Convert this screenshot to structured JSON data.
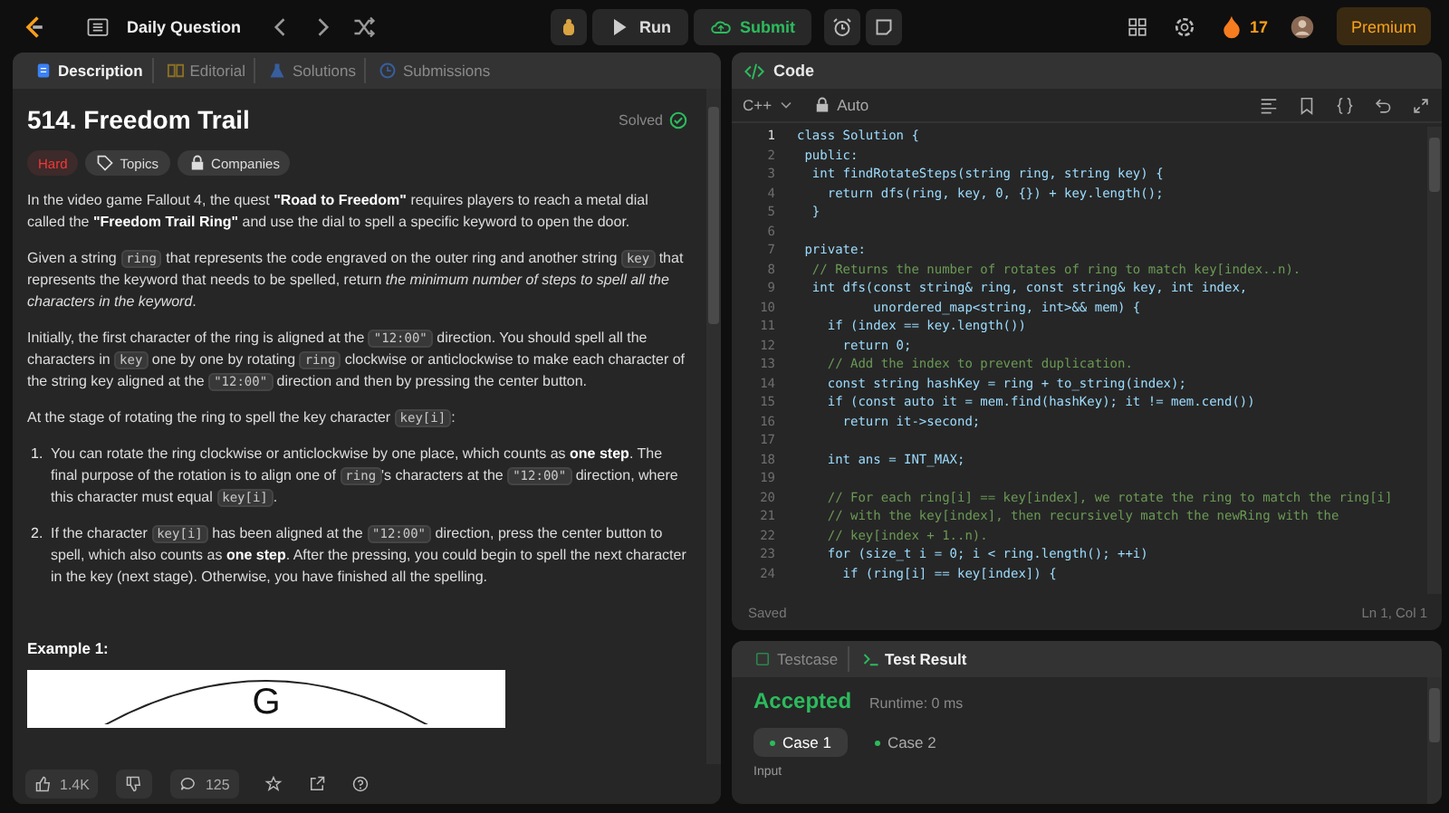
{
  "top_bar": {
    "nav_label": "Daily Question",
    "run_label": "Run",
    "submit_label": "Submit",
    "streak": "17",
    "premium_label": "Premium"
  },
  "description_panel": {
    "tabs": [
      {
        "label": "Description",
        "selected": true
      },
      {
        "label": "Editorial",
        "selected": false
      },
      {
        "label": "Solutions",
        "selected": false
      },
      {
        "label": "Submissions",
        "selected": false
      }
    ],
    "title": "514. Freedom Trail",
    "status": "Solved",
    "tags": [
      {
        "label": "Hard",
        "kind": "difficulty"
      },
      {
        "label": "Topics",
        "kind": "topic"
      },
      {
        "label": "Companies",
        "kind": "company"
      }
    ],
    "paragraphs": [
      [
        {
          "kind": "text",
          "text": "In the video game Fallout 4, the quest "
        },
        {
          "kind": "bold",
          "text": "\"Road to Freedom\""
        },
        {
          "kind": "text",
          "text": " requires players to reach a metal dial called the "
        },
        {
          "kind": "bold",
          "text": "\"Freedom Trail Ring\""
        },
        {
          "kind": "text",
          "text": " and use the dial to spell a specific keyword to open the door."
        }
      ],
      [
        {
          "kind": "text",
          "text": "Given a string "
        },
        {
          "kind": "code",
          "text": "ring"
        },
        {
          "kind": "text",
          "text": " that represents the code engraved on the outer ring and another string "
        },
        {
          "kind": "code",
          "text": "key"
        },
        {
          "kind": "text",
          "text": " that represents the keyword that needs to be spelled, return "
        },
        {
          "kind": "italic",
          "text": "the minimum number of steps to spell all the characters in the keyword"
        },
        {
          "kind": "text",
          "text": "."
        }
      ],
      [
        {
          "kind": "text",
          "text": "Initially, the first character of the ring is aligned at the "
        },
        {
          "kind": "code",
          "text": "\"12:00\""
        },
        {
          "kind": "text",
          "text": " direction. You should spell all the characters in "
        },
        {
          "kind": "code",
          "text": "key"
        },
        {
          "kind": "text",
          "text": " one by one by rotating "
        },
        {
          "kind": "code",
          "text": "ring"
        },
        {
          "kind": "text",
          "text": " clockwise or anticlockwise to make each character of the string key aligned at the "
        },
        {
          "kind": "code",
          "text": "\"12:00\""
        },
        {
          "kind": "text",
          "text": " direction and then by pressing the center button."
        }
      ],
      [
        {
          "kind": "text",
          "text": "At the stage of rotating the ring to spell the key character "
        },
        {
          "kind": "code",
          "text": "key[i]"
        },
        {
          "kind": "text",
          "text": ":"
        }
      ]
    ],
    "steps": [
      {
        "number": "1.",
        "segments": [
          {
            "kind": "text",
            "text": "You can rotate the ring clockwise or anticlockwise by one place, which counts as "
          },
          {
            "kind": "bold",
            "text": "one step"
          },
          {
            "kind": "text",
            "text": ". The final purpose of the rotation is to align one of "
          },
          {
            "kind": "code",
            "text": "ring"
          },
          {
            "kind": "text",
            "text": "'s characters at the "
          },
          {
            "kind": "code",
            "text": "\"12:00\""
          },
          {
            "kind": "text",
            "text": " direction, where this character must equal "
          },
          {
            "kind": "code",
            "text": "key[i]"
          },
          {
            "kind": "text",
            "text": "."
          }
        ]
      },
      {
        "number": "2.",
        "segments": [
          {
            "kind": "text",
            "text": "If the character "
          },
          {
            "kind": "code",
            "text": "key[i]"
          },
          {
            "kind": "text",
            "text": " has been aligned at the "
          },
          {
            "kind": "code",
            "text": "\"12:00\""
          },
          {
            "kind": "text",
            "text": " direction, press the center button to spell, which also counts as "
          },
          {
            "kind": "bold",
            "text": "one step"
          },
          {
            "kind": "text",
            "text": ". After the pressing, you could begin to spell the next character in the key (next stage). Otherwise, you have finished all the spelling."
          }
        ]
      }
    ],
    "example_heading": "Example 1:",
    "example_letter": "G",
    "footer": {
      "likes": "1.4K",
      "comments": "125"
    }
  },
  "code_panel": {
    "title": "Code",
    "language": "C++",
    "mode": "Auto",
    "lines": [
      {
        "number": "1",
        "kind": "code",
        "text": "class Solution {",
        "current": true
      },
      {
        "number": "2",
        "kind": "code",
        "text": " public:",
        "current": false
      },
      {
        "number": "3",
        "kind": "code",
        "text": "  int findRotateSteps(string ring, string key) {",
        "current": false
      },
      {
        "number": "4",
        "kind": "code",
        "text": "    return dfs(ring, key, 0, {}) + key.length();",
        "current": false
      },
      {
        "number": "5",
        "kind": "code",
        "text": "  }",
        "current": false
      },
      {
        "number": "6",
        "current": false
      },
      {
        "number": "7",
        "kind": "code",
        "text": " private:",
        "current": false
      },
      {
        "number": "8",
        "kind": "comment",
        "text": "  // Returns the number of rotates of ring to match key[index..n).",
        "current": false
      },
      {
        "number": "9",
        "kind": "code",
        "text": "  int dfs(const string& ring, const string& key, int index,",
        "current": false
      },
      {
        "number": "10",
        "kind": "code",
        "text": "          unordered_map<string, int>&& mem) {",
        "current": false
      },
      {
        "number": "11",
        "kind": "code",
        "text": "    if (index == key.length())",
        "current": false
      },
      {
        "number": "12",
        "kind": "code",
        "text": "      return 0;",
        "current": false
      },
      {
        "number": "13",
        "kind": "comment",
        "text": "    // Add the index to prevent duplication.",
        "current": false
      },
      {
        "number": "14",
        "kind": "code",
        "text": "    const string hashKey = ring + to_string(index);",
        "current": false
      },
      {
        "number": "15",
        "kind": "code",
        "text": "    if (const auto it = mem.find(hashKey); it != mem.cend())",
        "current": false
      },
      {
        "number": "16",
        "kind": "code",
        "text": "      return it->second;",
        "current": false
      },
      {
        "number": "17",
        "current": false
      },
      {
        "number": "18",
        "kind": "code",
        "text": "    int ans = INT_MAX;",
        "current": false
      },
      {
        "number": "19",
        "current": false
      },
      {
        "number": "20",
        "kind": "comment",
        "text": "    // For each ring[i] == key[index], we rotate the ring to match the ring[i]",
        "current": false
      },
      {
        "number": "21",
        "kind": "comment",
        "text": "    // with the key[index], then recursively match the newRing with the",
        "current": false
      },
      {
        "number": "22",
        "kind": "comment",
        "text": "    // key[index + 1..n).",
        "current": false
      },
      {
        "number": "23",
        "kind": "code",
        "text": "    for (size_t i = 0; i < ring.length(); ++i)",
        "current": false
      },
      {
        "number": "24",
        "kind": "code",
        "text": "      if (ring[i] == key[index]) {",
        "current": false
      }
    ],
    "save_status": "Saved",
    "cursor": "Ln 1, Col 1"
  },
  "result_panel": {
    "tabs": [
      {
        "label": "Testcase",
        "selected": false
      },
      {
        "label": "Test Result",
        "selected": true
      }
    ],
    "verdict": "Accepted",
    "runtime": "Runtime: 0 ms",
    "cases": [
      {
        "label": "Case 1",
        "selected": true
      },
      {
        "label": "Case 2",
        "selected": false
      }
    ],
    "input_label": "Input"
  }
}
